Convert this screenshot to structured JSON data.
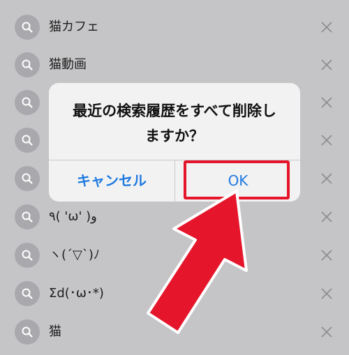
{
  "history": {
    "items": [
      {
        "label": "猫カフェ"
      },
      {
        "label": "猫動画"
      },
      {
        "label": ""
      },
      {
        "label": ""
      },
      {
        "label": ""
      },
      {
        "label": "٩( 'ω' )و"
      },
      {
        "label": "ヽ(´▽`)ﾉ"
      },
      {
        "label": "Σd(･ω･*)"
      },
      {
        "label": "猫"
      }
    ]
  },
  "dialog": {
    "message_line1": "最近の検索履歴をすべて削除し",
    "message_line2": "ますか？",
    "cancel_label": "キャンセル",
    "ok_label": "OK"
  },
  "colors": {
    "button_blue": "#1f7ae0",
    "annotation_red": "#e5162b"
  },
  "icons": {
    "row_icon": "search-icon",
    "row_delete": "close-icon",
    "annotation": "red-arrow-icon"
  }
}
